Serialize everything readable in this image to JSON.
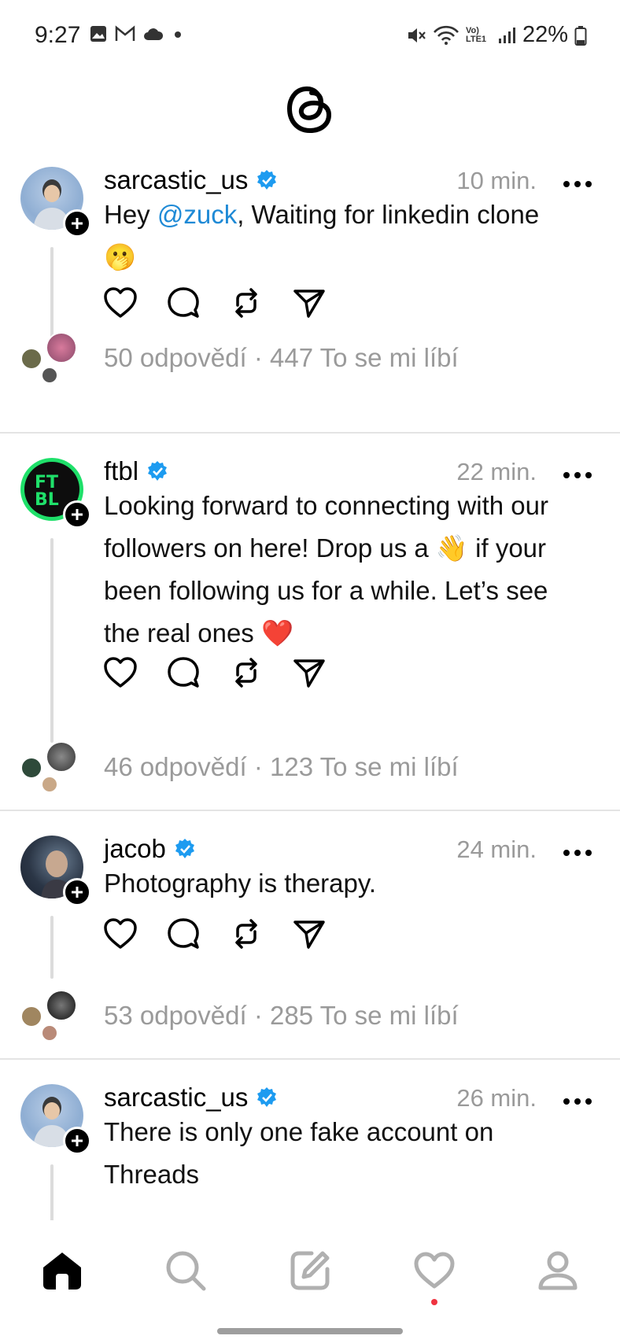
{
  "status_bar": {
    "time": "9:27",
    "battery": "22%",
    "network_label": "Vo) LTE1",
    "icons": [
      "gallery-icon",
      "gmail-icon",
      "cloud-icon",
      "dot-icon",
      "mute-icon",
      "wifi-icon",
      "signal-icon",
      "battery-icon"
    ]
  },
  "header": {
    "logo": "threads-logo-icon"
  },
  "posts": [
    {
      "username": "sarcastic_us",
      "verified": true,
      "time": "10 min.",
      "text_prefix": "Hey ",
      "mention": "@zuck",
      "text_suffix": ", Waiting for linkedin clone",
      "emoji": "🫢",
      "stats": "50 odpovědí · 447 To se mi líbí"
    },
    {
      "username": "ftbl",
      "verified": true,
      "time": "22 min.",
      "line1": "Looking forward to connecting with our",
      "line2a": "followers on here! Drop us a ",
      "line2_emoji": "👋",
      "line2b": " if your",
      "line3": "been following us for a while. Let’s see",
      "line4": "the real ones ",
      "line4_emoji": "❤️",
      "stats": "46 odpovědí · 123 To se mi líbí"
    },
    {
      "username": "jacob",
      "verified": true,
      "time": "24 min.",
      "text": "Photography is therapy.",
      "stats": "53 odpovědí · 285 To se mi líbí"
    },
    {
      "username": "sarcastic_us",
      "verified": true,
      "time": "26 min.",
      "line1": "There is only one fake account on",
      "line2": "Threads"
    }
  ],
  "nav": {
    "items": [
      "home-icon",
      "search-icon",
      "compose-icon",
      "activity-heart-icon",
      "profile-icon"
    ]
  },
  "colors": {
    "accent": "#1f8ad6",
    "verified": "#1d9bf0",
    "muted": "#9a9a9a",
    "notification_dot": "#ef3340"
  }
}
